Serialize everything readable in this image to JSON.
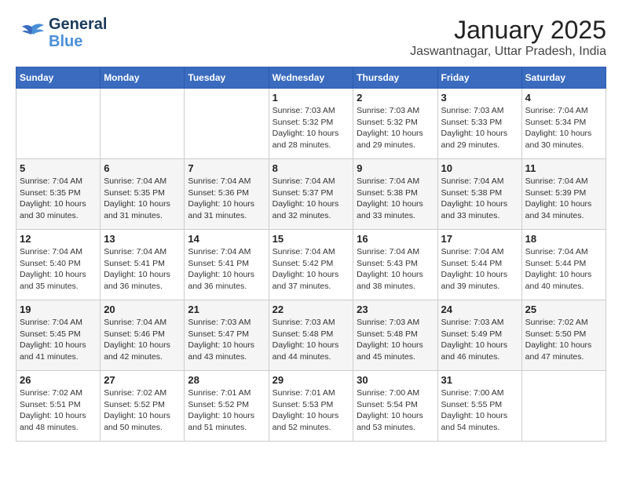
{
  "header": {
    "logo_line1": "General",
    "logo_line2": "Blue",
    "title": "January 2025",
    "subtitle": "Jaswantnagar, Uttar Pradesh, India"
  },
  "days_of_week": [
    "Sunday",
    "Monday",
    "Tuesday",
    "Wednesday",
    "Thursday",
    "Friday",
    "Saturday"
  ],
  "weeks": [
    [
      {
        "day": "",
        "info": ""
      },
      {
        "day": "",
        "info": ""
      },
      {
        "day": "",
        "info": ""
      },
      {
        "day": "1",
        "info": "Sunrise: 7:03 AM\nSunset: 5:32 PM\nDaylight: 10 hours and 28 minutes."
      },
      {
        "day": "2",
        "info": "Sunrise: 7:03 AM\nSunset: 5:32 PM\nDaylight: 10 hours and 29 minutes."
      },
      {
        "day": "3",
        "info": "Sunrise: 7:03 AM\nSunset: 5:33 PM\nDaylight: 10 hours and 29 minutes."
      },
      {
        "day": "4",
        "info": "Sunrise: 7:04 AM\nSunset: 5:34 PM\nDaylight: 10 hours and 30 minutes."
      }
    ],
    [
      {
        "day": "5",
        "info": "Sunrise: 7:04 AM\nSunset: 5:35 PM\nDaylight: 10 hours and 30 minutes."
      },
      {
        "day": "6",
        "info": "Sunrise: 7:04 AM\nSunset: 5:35 PM\nDaylight: 10 hours and 31 minutes."
      },
      {
        "day": "7",
        "info": "Sunrise: 7:04 AM\nSunset: 5:36 PM\nDaylight: 10 hours and 31 minutes."
      },
      {
        "day": "8",
        "info": "Sunrise: 7:04 AM\nSunset: 5:37 PM\nDaylight: 10 hours and 32 minutes."
      },
      {
        "day": "9",
        "info": "Sunrise: 7:04 AM\nSunset: 5:38 PM\nDaylight: 10 hours and 33 minutes."
      },
      {
        "day": "10",
        "info": "Sunrise: 7:04 AM\nSunset: 5:38 PM\nDaylight: 10 hours and 33 minutes."
      },
      {
        "day": "11",
        "info": "Sunrise: 7:04 AM\nSunset: 5:39 PM\nDaylight: 10 hours and 34 minutes."
      }
    ],
    [
      {
        "day": "12",
        "info": "Sunrise: 7:04 AM\nSunset: 5:40 PM\nDaylight: 10 hours and 35 minutes."
      },
      {
        "day": "13",
        "info": "Sunrise: 7:04 AM\nSunset: 5:41 PM\nDaylight: 10 hours and 36 minutes."
      },
      {
        "day": "14",
        "info": "Sunrise: 7:04 AM\nSunset: 5:41 PM\nDaylight: 10 hours and 36 minutes."
      },
      {
        "day": "15",
        "info": "Sunrise: 7:04 AM\nSunset: 5:42 PM\nDaylight: 10 hours and 37 minutes."
      },
      {
        "day": "16",
        "info": "Sunrise: 7:04 AM\nSunset: 5:43 PM\nDaylight: 10 hours and 38 minutes."
      },
      {
        "day": "17",
        "info": "Sunrise: 7:04 AM\nSunset: 5:44 PM\nDaylight: 10 hours and 39 minutes."
      },
      {
        "day": "18",
        "info": "Sunrise: 7:04 AM\nSunset: 5:44 PM\nDaylight: 10 hours and 40 minutes."
      }
    ],
    [
      {
        "day": "19",
        "info": "Sunrise: 7:04 AM\nSunset: 5:45 PM\nDaylight: 10 hours and 41 minutes."
      },
      {
        "day": "20",
        "info": "Sunrise: 7:04 AM\nSunset: 5:46 PM\nDaylight: 10 hours and 42 minutes."
      },
      {
        "day": "21",
        "info": "Sunrise: 7:03 AM\nSunset: 5:47 PM\nDaylight: 10 hours and 43 minutes."
      },
      {
        "day": "22",
        "info": "Sunrise: 7:03 AM\nSunset: 5:48 PM\nDaylight: 10 hours and 44 minutes."
      },
      {
        "day": "23",
        "info": "Sunrise: 7:03 AM\nSunset: 5:48 PM\nDaylight: 10 hours and 45 minutes."
      },
      {
        "day": "24",
        "info": "Sunrise: 7:03 AM\nSunset: 5:49 PM\nDaylight: 10 hours and 46 minutes."
      },
      {
        "day": "25",
        "info": "Sunrise: 7:02 AM\nSunset: 5:50 PM\nDaylight: 10 hours and 47 minutes."
      }
    ],
    [
      {
        "day": "26",
        "info": "Sunrise: 7:02 AM\nSunset: 5:51 PM\nDaylight: 10 hours and 48 minutes."
      },
      {
        "day": "27",
        "info": "Sunrise: 7:02 AM\nSunset: 5:52 PM\nDaylight: 10 hours and 50 minutes."
      },
      {
        "day": "28",
        "info": "Sunrise: 7:01 AM\nSunset: 5:52 PM\nDaylight: 10 hours and 51 minutes."
      },
      {
        "day": "29",
        "info": "Sunrise: 7:01 AM\nSunset: 5:53 PM\nDaylight: 10 hours and 52 minutes."
      },
      {
        "day": "30",
        "info": "Sunrise: 7:00 AM\nSunset: 5:54 PM\nDaylight: 10 hours and 53 minutes."
      },
      {
        "day": "31",
        "info": "Sunrise: 7:00 AM\nSunset: 5:55 PM\nDaylight: 10 hours and 54 minutes."
      },
      {
        "day": "",
        "info": ""
      }
    ]
  ]
}
